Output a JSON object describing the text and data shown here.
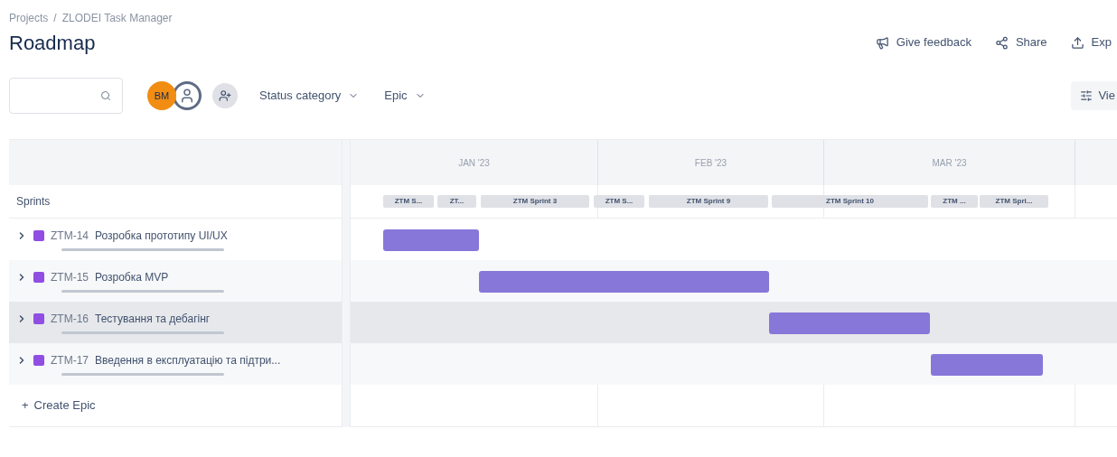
{
  "breadcrumbs": [
    "Projects",
    "/",
    "ZLODEI Task Manager"
  ],
  "title": "Roadmap",
  "actions": [
    {
      "kind": "feedback",
      "label": "Give feedback"
    },
    {
      "kind": "share",
      "label": "Share"
    },
    {
      "kind": "export",
      "label": "Exp"
    }
  ],
  "avatars": [
    {
      "kind": "initials",
      "label": "BM",
      "color": "#f18d13"
    },
    {
      "kind": "person",
      "color": "#5e6c84"
    },
    {
      "kind": "add"
    }
  ],
  "filters": [
    {
      "label": "Status category"
    },
    {
      "label": "Epic"
    }
  ],
  "view_button": {
    "label": "Vie"
  },
  "months": [
    "JAN '23",
    "FEB '23",
    "MAR '23"
  ],
  "sprints_label": "Sprints",
  "sprints": [
    "ZTM S...",
    "ZT...",
    "ZTM Sprint 3",
    "ZTM S...",
    "ZTM Sprint 9",
    "ZTM Sprint 10",
    "ZTM ...",
    "ZTM Spri..."
  ],
  "epics": [
    {
      "key": "ZTM-14",
      "name": "Розробка прототипу UI/UX",
      "highlighted": false
    },
    {
      "key": "ZTM-15",
      "name": "Розробка MVP",
      "highlighted": false
    },
    {
      "key": "ZTM-16",
      "name": "Тестування та дебагінг",
      "highlighted": true
    },
    {
      "key": "ZTM-17",
      "name": "Введення в експлуатацію та підтри...",
      "highlighted": false
    }
  ],
  "create_epic": {
    "icon": "+",
    "label": "Create Epic"
  }
}
